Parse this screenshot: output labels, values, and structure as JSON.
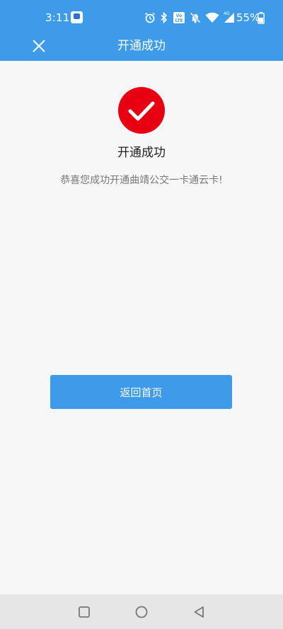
{
  "status_bar": {
    "time": "3:11",
    "battery": "55%",
    "network": "4G",
    "volte": "VoLTE"
  },
  "header": {
    "title": "开通成功",
    "close_icon": "close-icon"
  },
  "content": {
    "icon": "check-circle-icon",
    "title": "开通成功",
    "message": "恭喜您成功开通曲靖公交一卡通云卡!"
  },
  "actions": {
    "home_label": "返回首页"
  },
  "navigation": {
    "recents_icon": "square-icon",
    "home_icon": "circle-icon",
    "back_icon": "triangle-back-icon"
  },
  "colors": {
    "brand": "#3d9bea",
    "success": "#e60012",
    "background": "#f7f7f7"
  }
}
